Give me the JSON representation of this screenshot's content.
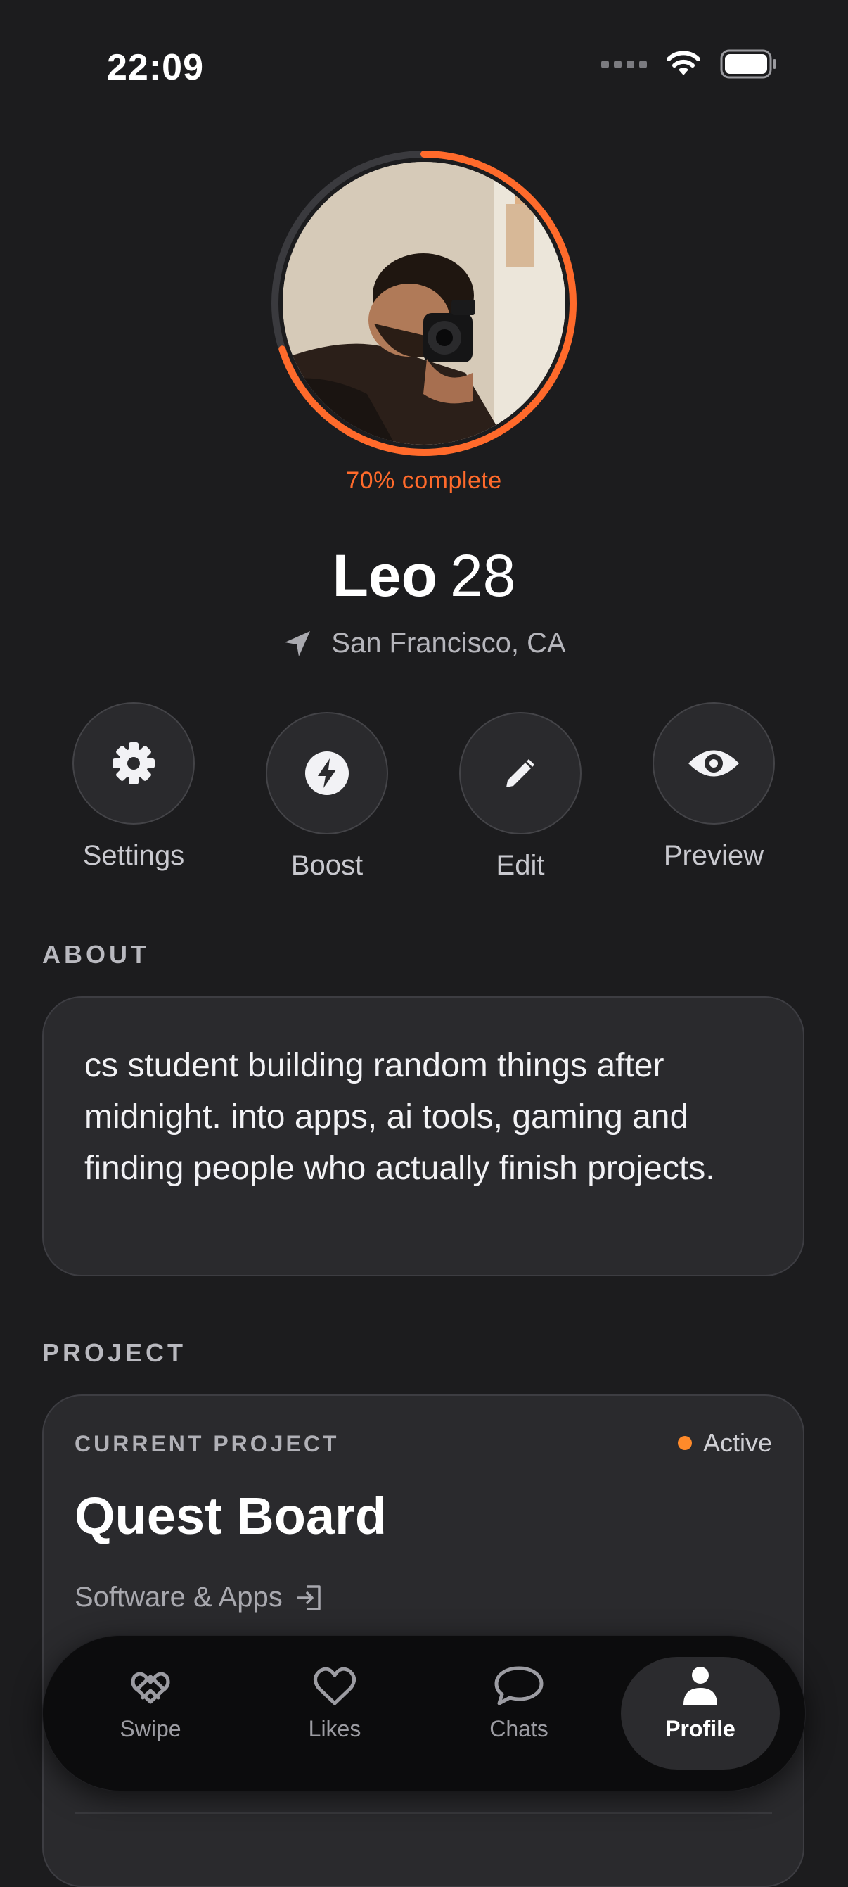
{
  "status_bar": {
    "time": "22:09"
  },
  "profile": {
    "completion_percent": 70,
    "completion_text": "70% complete",
    "name": "Leo",
    "age": "28",
    "location": "San Francisco, CA",
    "accent_color": "#ff6a2b"
  },
  "actions": [
    {
      "label": "Settings",
      "icon": "gear-icon"
    },
    {
      "label": "Boost",
      "icon": "bolt-icon"
    },
    {
      "label": "Edit",
      "icon": "pencil-icon"
    },
    {
      "label": "Preview",
      "icon": "eye-icon"
    }
  ],
  "about": {
    "heading": "ABOUT",
    "text": "cs student building random things after midnight. into apps, ai tools, gaming and finding people who actually finish projects."
  },
  "project": {
    "heading": "PROJECT",
    "kicker": "CURRENT PROJECT",
    "status": "Active",
    "status_color": "#ff8a2a",
    "title": "Quest Board",
    "category": "Software & Apps"
  },
  "tabs": [
    {
      "label": "Swipe",
      "icon": "swipe-icon",
      "active": false
    },
    {
      "label": "Likes",
      "icon": "heart-icon",
      "active": false
    },
    {
      "label": "Chats",
      "icon": "chat-bubble-icon",
      "active": false
    },
    {
      "label": "Profile",
      "icon": "person-icon",
      "active": true
    }
  ]
}
